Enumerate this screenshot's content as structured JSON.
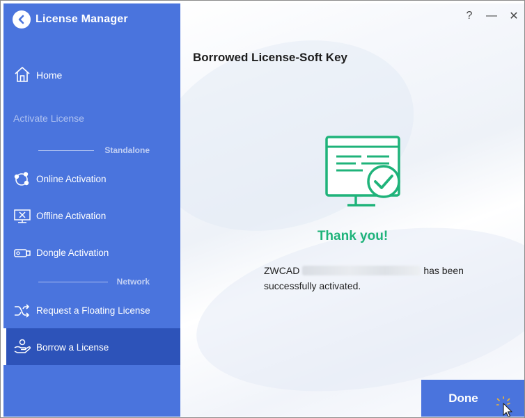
{
  "app": {
    "title": "License Manager",
    "back_icon": "back-arrow-circle-icon"
  },
  "window_controls": {
    "help": "?",
    "minimize": "—",
    "close": "✕"
  },
  "sidebar": {
    "home_label": "Home",
    "section_title": "Activate License",
    "groups": {
      "standalone": "Standalone",
      "network": "Network"
    },
    "items": [
      {
        "label": "Online Activation",
        "icon": "cloud-nodes-icon"
      },
      {
        "label": "Offline Activation",
        "icon": "monitor-x-icon"
      },
      {
        "label": "Dongle Activation",
        "icon": "usb-dongle-icon"
      },
      {
        "label": "Request a Floating License",
        "icon": "shuffle-icon"
      },
      {
        "label": "Borrow a License",
        "icon": "hand-user-icon",
        "active": true
      }
    ],
    "colors": {
      "background": "#4a74dd",
      "active": "#2d53b9"
    }
  },
  "main": {
    "page_title": "Borrowed License-Soft Key",
    "thank_you": "Thank you!",
    "message_prefix": "ZWCAD",
    "message_suffix": "has been",
    "message_line2": "successfully activated.",
    "success_icon": "monitor-checkmark-icon",
    "accent_color": "#1fb37a",
    "done_label": "Done"
  }
}
